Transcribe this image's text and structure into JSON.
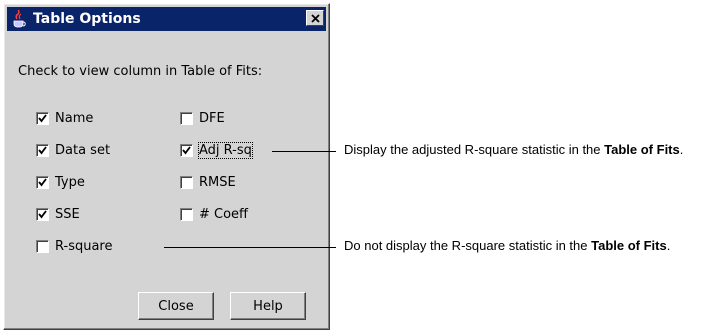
{
  "window": {
    "title": "Table Options",
    "icon": "matlab-java-cup-icon",
    "close_icon": "close-icon"
  },
  "instructions": "Check to view column in Table of Fits:",
  "options": {
    "name": {
      "label": "Name",
      "checked": true
    },
    "data_set": {
      "label": "Data set",
      "checked": true
    },
    "type": {
      "label": "Type",
      "checked": true
    },
    "sse": {
      "label": "SSE",
      "checked": true
    },
    "r_square": {
      "label": "R-square",
      "checked": false
    },
    "dfe": {
      "label": "DFE",
      "checked": false
    },
    "adj_r_sq": {
      "label": "Adj R-sq",
      "checked": true
    },
    "rmse": {
      "label": "RMSE",
      "checked": false
    },
    "num_coeff": {
      "label": "# Coeff",
      "checked": false
    }
  },
  "buttons": {
    "close": "Close",
    "help": "Help"
  },
  "callouts": {
    "adj_r_sq": {
      "prefix": "Display the adjusted R-square statistic in the ",
      "bold": "Table of Fits",
      "suffix": "."
    },
    "r_square": {
      "prefix": "Do not display the R-square statistic in the ",
      "bold": "Table of Fits",
      "suffix": "."
    }
  },
  "colors": {
    "titlebar": "#0a246a",
    "dialog_bg": "#d4d4d4"
  }
}
